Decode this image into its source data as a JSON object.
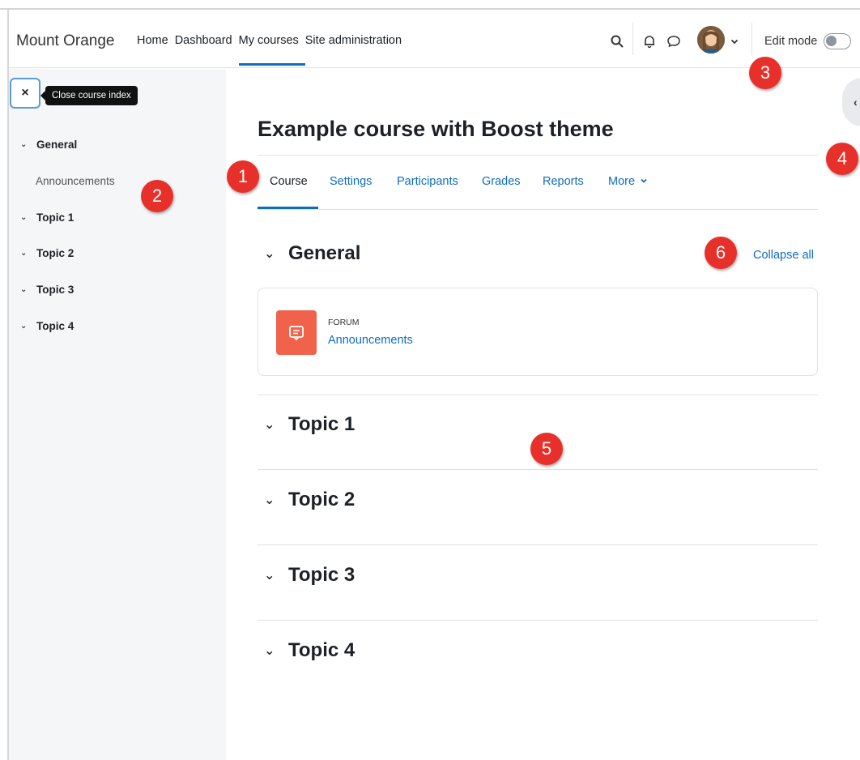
{
  "navbar": {
    "brand": "Mount Orange",
    "links": [
      {
        "label": "Home",
        "active": false
      },
      {
        "label": "Dashboard",
        "active": false
      },
      {
        "label": "My courses",
        "active": true
      },
      {
        "label": "Site administration",
        "active": false
      }
    ],
    "edit_mode_label": "Edit mode",
    "icons": [
      "search-icon",
      "bell-icon",
      "chat-icon",
      "chevron-down-icon"
    ]
  },
  "drawer": {
    "close_label": "×",
    "tooltip": "Close course index",
    "items": [
      {
        "label": "General",
        "expanded": true
      },
      {
        "label": "Announcements",
        "sub": true
      },
      {
        "label": "Topic 1"
      },
      {
        "label": "Topic 2"
      },
      {
        "label": "Topic 3"
      },
      {
        "label": "Topic 4"
      }
    ]
  },
  "main": {
    "title": "Example course with Boost theme",
    "tabs": [
      {
        "label": "Course",
        "active": true
      },
      {
        "label": "Settings"
      },
      {
        "label": "Participants"
      },
      {
        "label": "Grades"
      },
      {
        "label": "Reports"
      },
      {
        "label": "More"
      }
    ],
    "more_chevron": "⌄",
    "collapse_all": "Collapse all",
    "sections": [
      "General",
      "Topic 1",
      "Topic 2",
      "Topic 3",
      "Topic 4"
    ],
    "activity": {
      "type": "Forum",
      "name": "Announcements"
    }
  },
  "badges": [
    "1",
    "2",
    "3",
    "4",
    "5",
    "6"
  ],
  "colors": {
    "accent": "#0f6cbf",
    "badge": "#e8302a",
    "forum": "#f0624a",
    "drawer_bg": "#f5f6f8"
  }
}
